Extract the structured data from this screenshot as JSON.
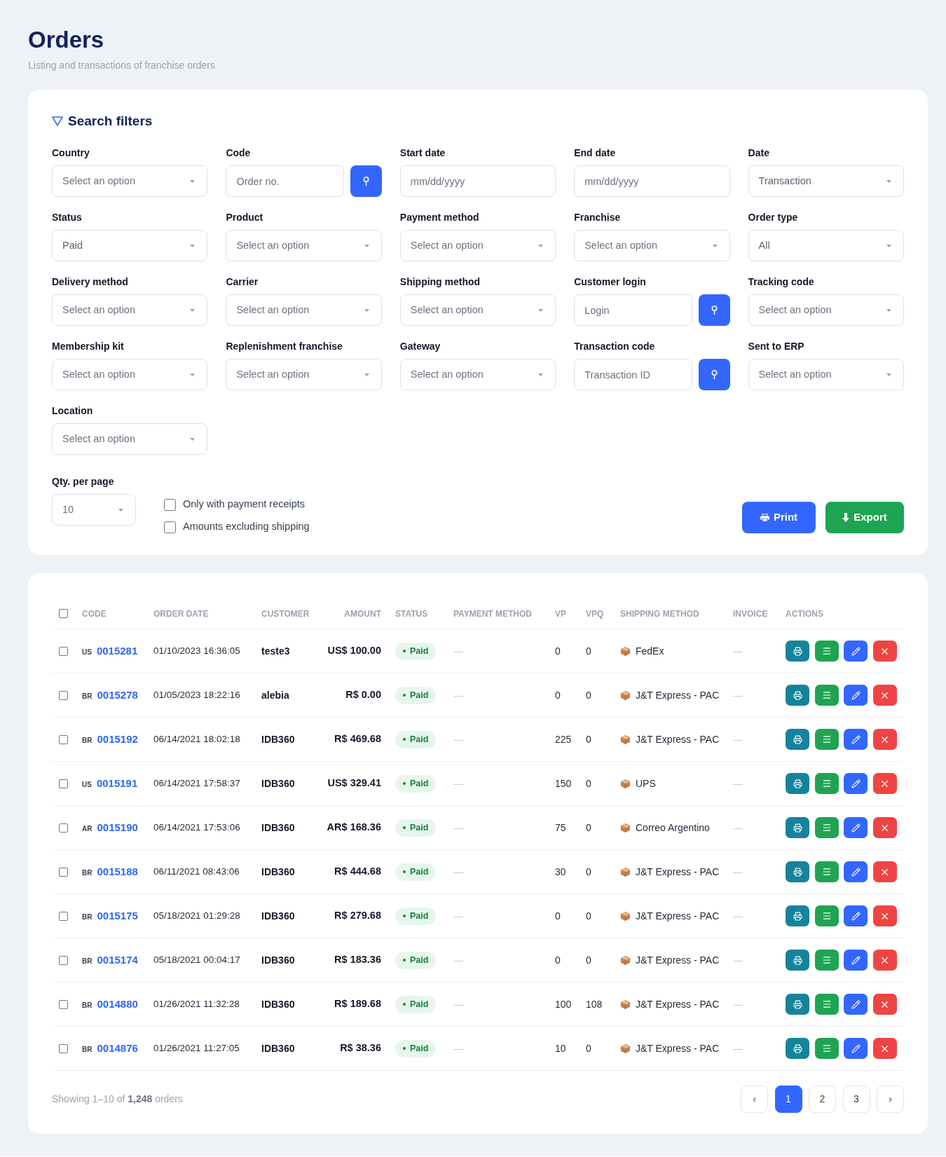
{
  "page": {
    "title": "Orders",
    "subtitle": "Listing and transactions of franchise orders"
  },
  "filters": {
    "title": "Search filters",
    "fields": [
      {
        "label": "Country",
        "kind": "select",
        "placeholder": "Select an option"
      },
      {
        "label": "Code",
        "kind": "search",
        "placeholder": "Order no."
      },
      {
        "label": "Start date",
        "kind": "date",
        "placeholder": "mm/dd/yyyy"
      },
      {
        "label": "End date",
        "kind": "date",
        "placeholder": "mm/dd/yyyy"
      },
      {
        "label": "Date",
        "kind": "select",
        "value": "Transaction"
      },
      {
        "label": "Status",
        "kind": "select",
        "value": "Paid"
      },
      {
        "label": "Product",
        "kind": "select",
        "placeholder": "Select an option"
      },
      {
        "label": "Payment method",
        "kind": "select",
        "placeholder": "Select an option"
      },
      {
        "label": "Franchise",
        "kind": "select",
        "placeholder": "Select an option"
      },
      {
        "label": "Order type",
        "kind": "select",
        "value": "All"
      },
      {
        "label": "Delivery method",
        "kind": "select",
        "placeholder": "Select an option"
      },
      {
        "label": "Carrier",
        "kind": "select",
        "placeholder": "Select an option"
      },
      {
        "label": "Shipping method",
        "kind": "select",
        "placeholder": "Select an option"
      },
      {
        "label": "Customer login",
        "kind": "search",
        "placeholder": "Login"
      },
      {
        "label": "Tracking code",
        "kind": "select",
        "placeholder": "Select an option"
      },
      {
        "label": "Membership kit",
        "kind": "select",
        "placeholder": "Select an option"
      },
      {
        "label": "Replenishment franchise",
        "kind": "select",
        "placeholder": "Select an option"
      },
      {
        "label": "Gateway",
        "kind": "select",
        "placeholder": "Select an option"
      },
      {
        "label": "Transaction code",
        "kind": "search",
        "placeholder": "Transaction ID"
      },
      {
        "label": "Sent to ERP",
        "kind": "select",
        "placeholder": "Select an option"
      },
      {
        "label": "Location",
        "kind": "select",
        "placeholder": "Select an option"
      }
    ],
    "per_page": {
      "label": "Qty. per page",
      "value": "10"
    },
    "options": [
      {
        "label": "Only with payment receipts",
        "checked": false
      },
      {
        "label": "Amounts excluding shipping",
        "checked": false
      }
    ],
    "buttons": [
      {
        "label": "Print",
        "kind": "print"
      },
      {
        "label": "Export",
        "kind": "export"
      }
    ]
  },
  "table": {
    "select_all": {
      "checked": false
    },
    "columns": [
      "CODE",
      "ORDER DATE",
      "CUSTOMER",
      "AMOUNT",
      "STATUS",
      "PAYMENT METHOD",
      "VP",
      "VPQ",
      "SHIPPING METHOD",
      "INVOICE",
      "ACTIONS"
    ],
    "rows": [
      {
        "checked": false,
        "country": "US",
        "code": "0015281",
        "order_date": "01/10/2023 16:36:05",
        "customer": "teste3",
        "amount": "US$ 100.00",
        "status": "Paid",
        "payment_method": "—",
        "vp": "0",
        "vpq": "0",
        "shipping_method": "FedEx",
        "invoice": "—"
      },
      {
        "checked": false,
        "country": "BR",
        "code": "0015278",
        "order_date": "01/05/2023 18:22:16",
        "customer": "alebia",
        "amount": "R$ 0.00",
        "status": "Paid",
        "payment_method": "—",
        "vp": "0",
        "vpq": "0",
        "shipping_method": "J&T Express - PAC",
        "invoice": "—"
      },
      {
        "checked": false,
        "country": "BR",
        "code": "0015192",
        "order_date": "06/14/2021 18:02:18",
        "customer": "IDB360",
        "amount": "R$ 469.68",
        "status": "Paid",
        "payment_method": "—",
        "vp": "225",
        "vpq": "0",
        "shipping_method": "J&T Express - PAC",
        "invoice": "—"
      },
      {
        "checked": false,
        "country": "US",
        "code": "0015191",
        "order_date": "06/14/2021 17:58:37",
        "customer": "IDB360",
        "amount": "US$ 329.41",
        "status": "Paid",
        "payment_method": "—",
        "vp": "150",
        "vpq": "0",
        "shipping_method": "UPS",
        "invoice": "—"
      },
      {
        "checked": false,
        "country": "AR",
        "code": "0015190",
        "order_date": "06/14/2021 17:53:06",
        "customer": "IDB360",
        "amount": "AR$ 168.36",
        "status": "Paid",
        "payment_method": "—",
        "vp": "75",
        "vpq": "0",
        "shipping_method": "Correo Argentino",
        "invoice": "—"
      },
      {
        "checked": false,
        "country": "BR",
        "code": "0015188",
        "order_date": "06/11/2021 08:43:06",
        "customer": "IDB360",
        "amount": "R$ 444.68",
        "status": "Paid",
        "payment_method": "—",
        "vp": "30",
        "vpq": "0",
        "shipping_method": "J&T Express - PAC",
        "invoice": "—"
      },
      {
        "checked": false,
        "country": "BR",
        "code": "0015175",
        "order_date": "05/18/2021 01:29:28",
        "customer": "IDB360",
        "amount": "R$ 279.68",
        "status": "Paid",
        "payment_method": "—",
        "vp": "0",
        "vpq": "0",
        "shipping_method": "J&T Express - PAC",
        "invoice": "—"
      },
      {
        "checked": false,
        "country": "BR",
        "code": "0015174",
        "order_date": "05/18/2021 00:04:17",
        "customer": "IDB360",
        "amount": "R$ 183.36",
        "status": "Paid",
        "payment_method": "—",
        "vp": "0",
        "vpq": "0",
        "shipping_method": "J&T Express - PAC",
        "invoice": "—"
      },
      {
        "checked": false,
        "country": "BR",
        "code": "0014880",
        "order_date": "01/26/2021 11:32:28",
        "customer": "IDB360",
        "amount": "R$ 189.68",
        "status": "Paid",
        "payment_method": "—",
        "vp": "100",
        "vpq": "108",
        "shipping_method": "J&T Express - PAC",
        "invoice": "—"
      },
      {
        "checked": false,
        "country": "BR",
        "code": "0014876",
        "order_date": "01/26/2021 11:27:05",
        "customer": "IDB360",
        "amount": "R$ 38.36",
        "status": "Paid",
        "payment_method": "—",
        "vp": "10",
        "vpq": "0",
        "shipping_method": "J&T Express - PAC",
        "invoice": "—"
      }
    ]
  },
  "footer": {
    "summary": "Showing 1–10 of **1,248** orders",
    "pagination": {
      "prev": "‹",
      "pages": [
        {
          "label": "1",
          "selected": true
        },
        {
          "label": "2",
          "selected": false
        },
        {
          "label": "3",
          "selected": false
        }
      ],
      "next": "›"
    }
  }
}
